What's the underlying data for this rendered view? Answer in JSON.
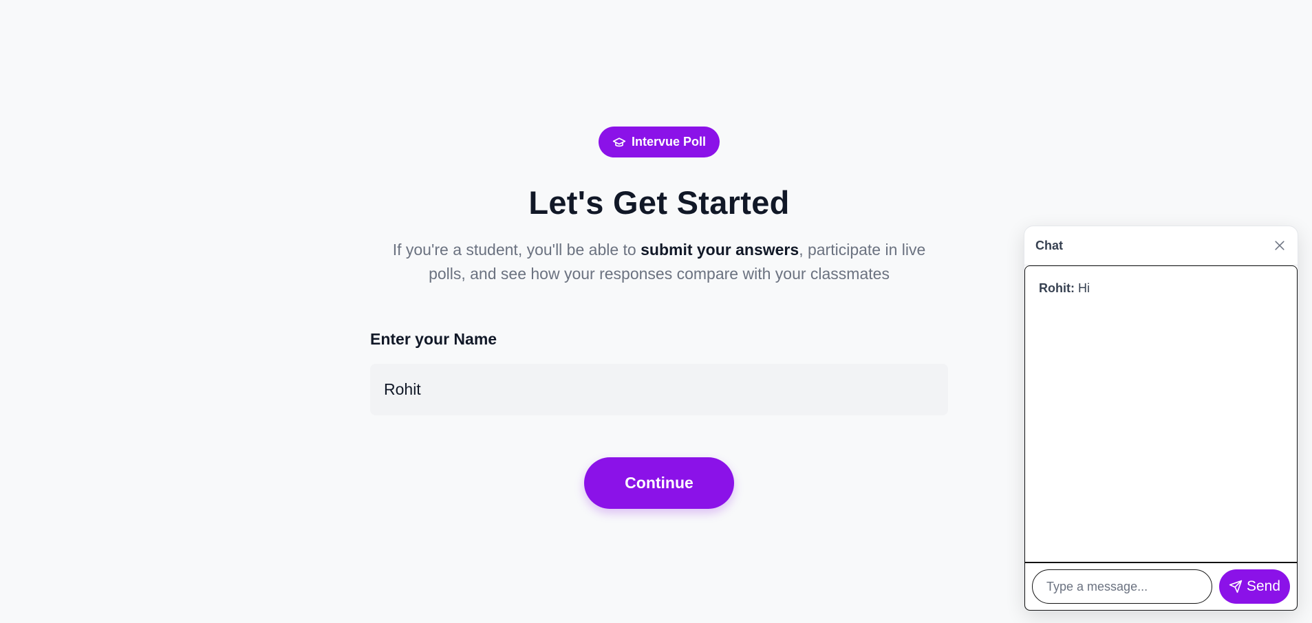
{
  "badge": {
    "label": "Intervue Poll",
    "icon": "graduation-cap-icon"
  },
  "heading": "Let's Get Started",
  "subtitle": {
    "before": "If you're a student, you'll be able to ",
    "bold": "submit your answers",
    "after": ", participate in live polls, and see how your responses compare with your classmates"
  },
  "form": {
    "name_label": "Enter your Name",
    "name_value": "Rohit",
    "continue_label": "Continue"
  },
  "chat": {
    "title": "Chat",
    "messages": [
      {
        "author": "Rohit:",
        "text": "Hi"
      }
    ],
    "input_placeholder": "Type a message...",
    "send_label": "Send",
    "close_icon": "close-icon",
    "send_icon": "send-icon"
  },
  "colors": {
    "accent": "#8b12e8",
    "background": "#f8f9fa",
    "heading": "#111827",
    "muted": "#6b7280"
  }
}
